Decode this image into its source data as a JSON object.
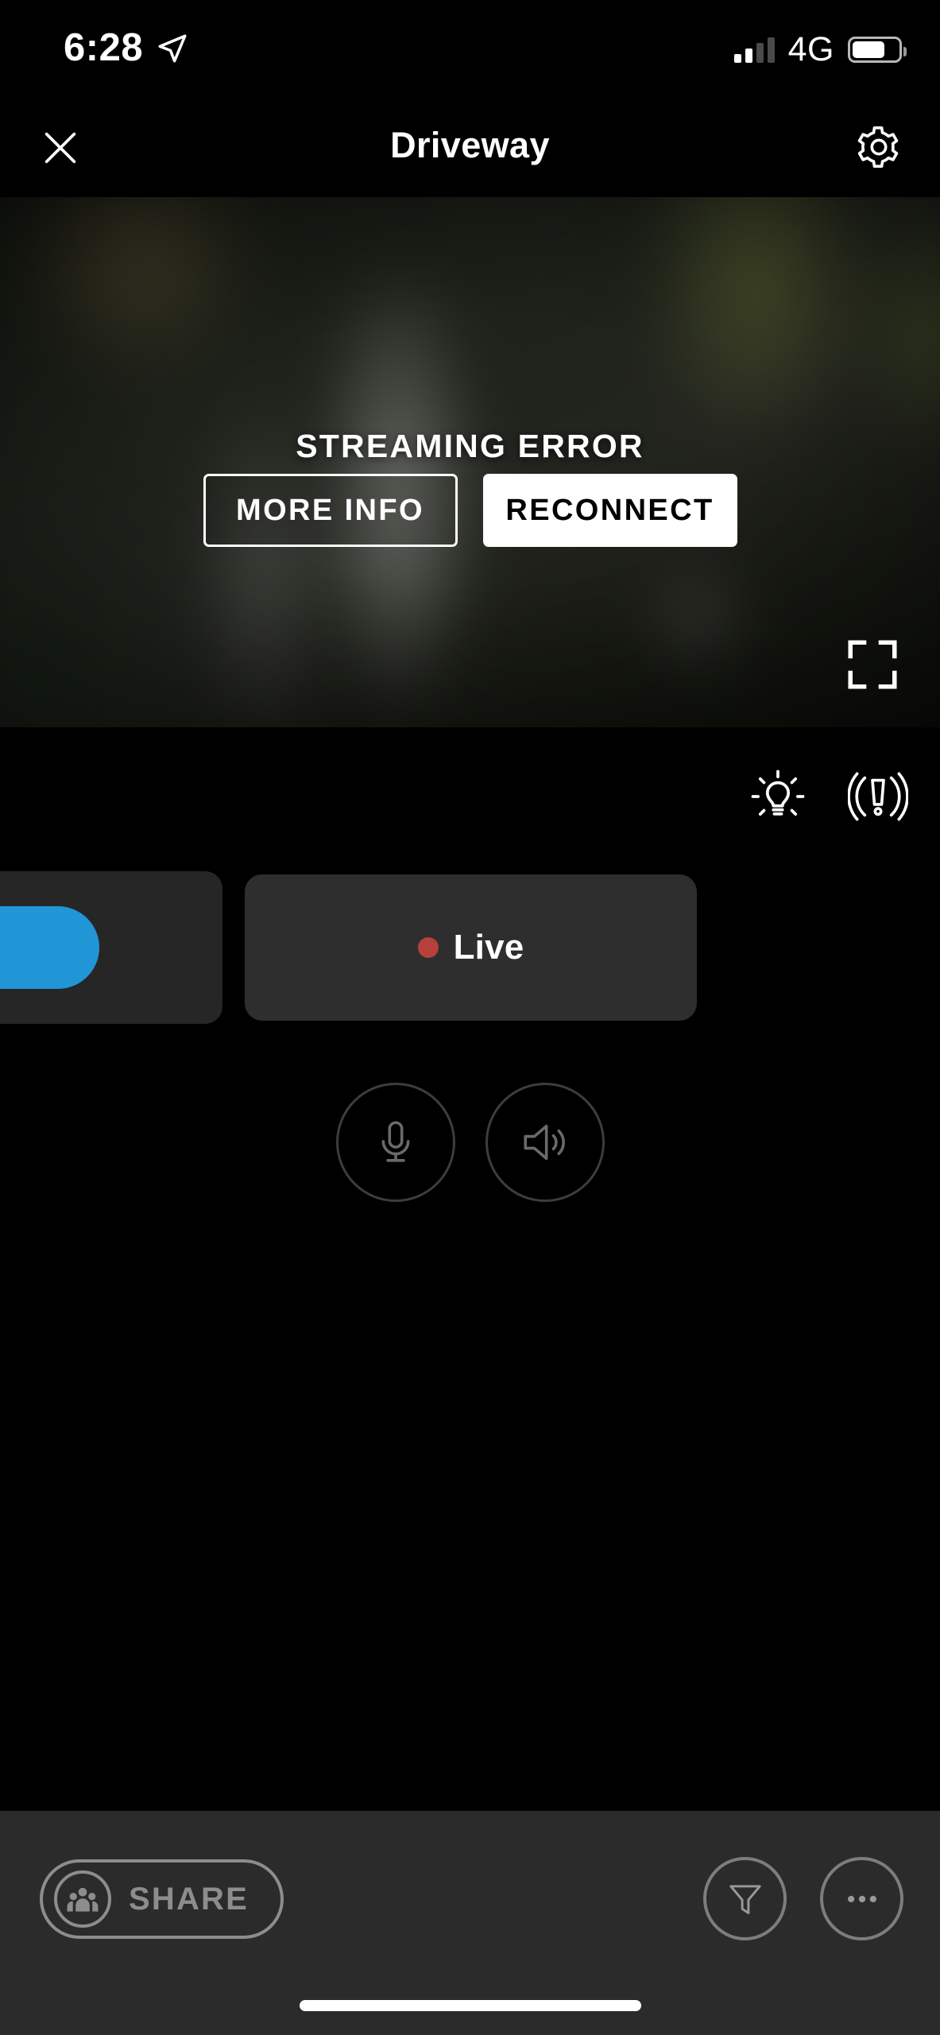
{
  "status_bar": {
    "time": "6:28",
    "location_icon": "location-arrow-icon",
    "signal_icon": "cellular-signal-icon",
    "signal_bars_filled": 2,
    "signal_bars_total": 4,
    "network": "4G",
    "battery_icon": "battery-icon",
    "battery_percent": 64
  },
  "nav_bar": {
    "close_icon": "close-icon",
    "title": "Driveway",
    "settings_icon": "gear-icon"
  },
  "video": {
    "error_title": "STREAMING ERROR",
    "more_info_label": "MORE INFO",
    "reconnect_label": "RECONNECT",
    "fullscreen_icon": "fullscreen-expand-icon"
  },
  "quick_actions": [
    {
      "icon": "light-bulb-icon",
      "name": "floodlight-toggle"
    },
    {
      "icon": "siren-alarm-icon",
      "name": "siren-toggle"
    }
  ],
  "timeline": {
    "scrubber_color": "#2196d6",
    "live_label": "Live",
    "live_dot_color": "#b5413a",
    "live_dot_icon": "live-record-dot"
  },
  "audio_controls": [
    {
      "icon": "microphone-icon",
      "name": "microphone-button"
    },
    {
      "icon": "speaker-volume-icon",
      "name": "speaker-button"
    }
  ],
  "toolbar": {
    "share_label": "SHARE",
    "share_icon": "people-group-icon",
    "filter_icon": "funnel-filter-icon",
    "more_icon": "ellipsis-more-icon"
  },
  "home_indicator": "home-indicator-bar"
}
